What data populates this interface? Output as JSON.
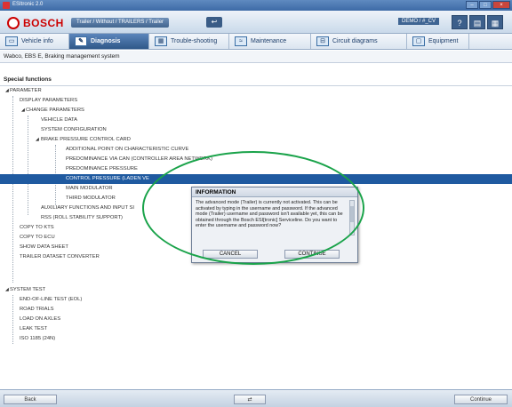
{
  "window": {
    "title": "ESItronic 2.0"
  },
  "header": {
    "brand": "BOSCH",
    "breadcrumb": "Trailer / Without / TRAILERS / Trailer",
    "user": "DEMO / #_CV",
    "icons": [
      "help-icon",
      "print-icon",
      "settings-icon"
    ]
  },
  "tabs": [
    {
      "label": "Vehicle info",
      "icon": "vehicle-info-icon",
      "active": false
    },
    {
      "label": "Diagnosis",
      "icon": "diagnosis-icon",
      "active": true
    },
    {
      "label": "Trouble-shooting",
      "icon": "trouble-shooting-icon",
      "active": false
    },
    {
      "label": "Maintenance",
      "icon": "maintenance-icon",
      "active": false
    },
    {
      "label": "Circuit diagrams",
      "icon": "circuit-diagrams-icon",
      "active": false
    },
    {
      "label": "Equipment",
      "icon": "equipment-icon",
      "active": false
    }
  ],
  "system": "Wabco, EBS E, Braking management system",
  "section_title": "Special functions",
  "tree": [
    {
      "label": "PARAMETER",
      "level": 0,
      "expanded": true
    },
    {
      "label": "DISPLAY PARAMETERS",
      "level": 1
    },
    {
      "label": "CHANGE PARAMETERS",
      "level": 1,
      "expanded": true
    },
    {
      "label": "VEHICLE DATA",
      "level": 2
    },
    {
      "label": "SYSTEM CONFIGURATION",
      "level": 2
    },
    {
      "label": "BRAKE PRESSURE CONTROL CARD",
      "level": 2,
      "expanded": true
    },
    {
      "label": "ADDITIONAL POINT ON CHARACTERISTIC CURVE",
      "level": 3
    },
    {
      "label": "PREDOMINANCE VIA CAN (CONTROLLER AREA NETWORK)",
      "level": 3
    },
    {
      "label": "PREDOMINANCE PRESSURE",
      "level": 3
    },
    {
      "label": "CONTROL PRESSURE (LADEN VE",
      "level": 3,
      "selected": true
    },
    {
      "label": "MAIN MODULATOR",
      "level": 3
    },
    {
      "label": "THIRD MODULATOR",
      "level": 3
    },
    {
      "label": "AUXILIARY FUNCTIONS AND INPUT SI",
      "level": 2
    },
    {
      "label": "RSS (ROLL STABILITY SUPPORT)",
      "level": 2
    },
    {
      "label": "COPY TO KTS",
      "level": 1
    },
    {
      "label": "COPY TO ECU",
      "level": 1
    },
    {
      "label": "SHOW DATA SHEET",
      "level": 1
    },
    {
      "label": "TRAILER DATASET CONVERTER",
      "level": 1
    },
    {
      "label": "SYSTEM TEST",
      "level": 0,
      "expanded": true
    },
    {
      "label": "END-OF-LINE TEST (EOL)",
      "level": 1
    },
    {
      "label": "ROAD TRIALS",
      "level": 1
    },
    {
      "label": "LOAD ON AXLES",
      "level": 1
    },
    {
      "label": "LEAK TEST",
      "level": 1
    },
    {
      "label": "ISO 1185 (24N)",
      "level": 1
    }
  ],
  "dialog": {
    "title": "INFORMATION",
    "message": "The advanced mode (Trailer) is currently not activated. This can be activated by typing in the username and password. If the advanced mode (Trailer) username and password isn't available yet, this can be obtained through the Bosch ESI[tronic] Serviceline. Do you want to enter the username and password now?",
    "cancel_label": "CANCEL",
    "continue_label": "CONTINUE"
  },
  "footer": {
    "back_label": "Back",
    "center_icon": "switch-arrows-icon",
    "continue_label": "Continue"
  }
}
